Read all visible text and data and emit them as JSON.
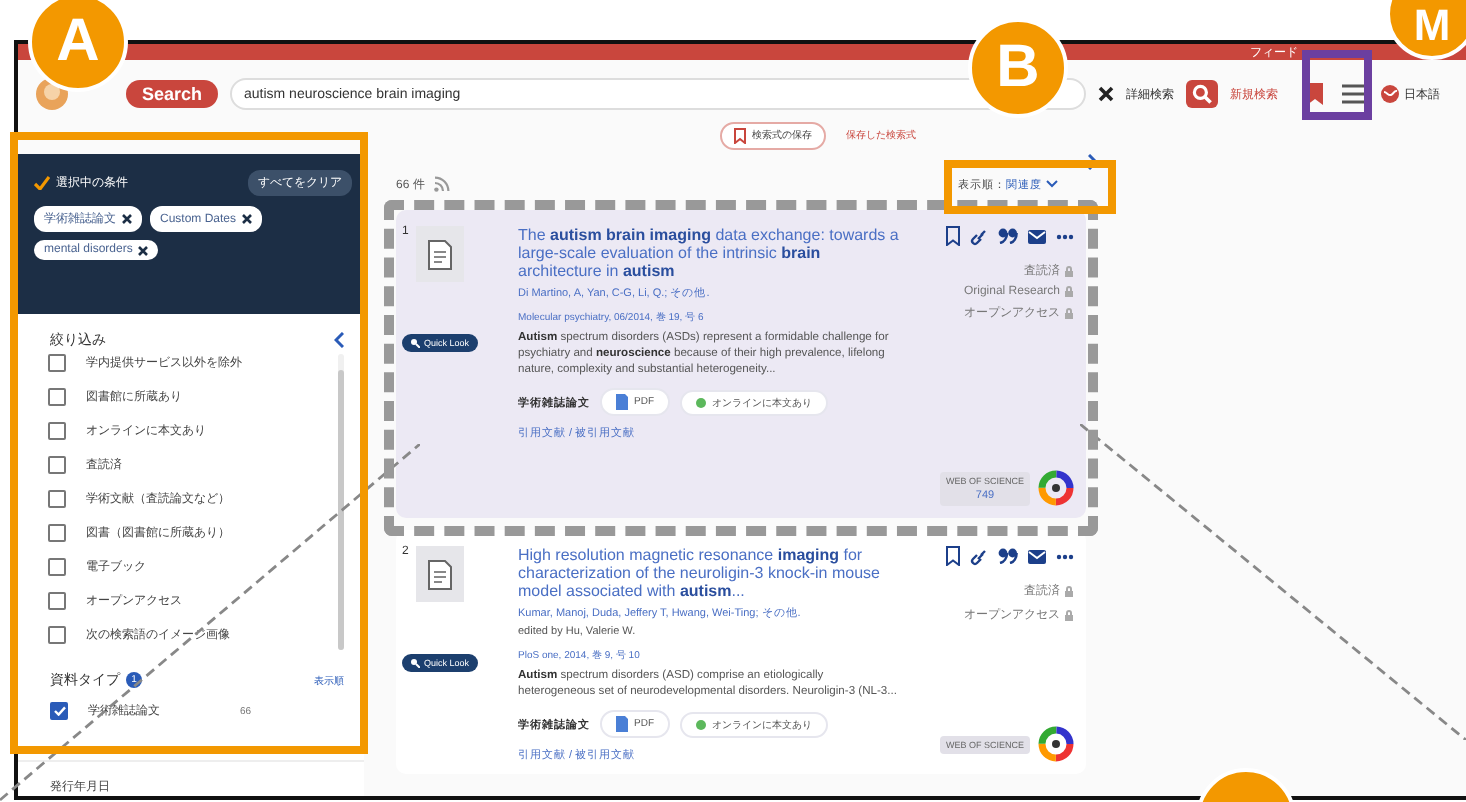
{
  "top_bar": {
    "text": "フィード"
  },
  "header": {
    "logo": "Search",
    "query": "autism neuroscience brain imaging",
    "advanced": "詳細検索",
    "new_search": "新規検索",
    "language": "日本語"
  },
  "sub_bar": {
    "save_query": "検索式の保存",
    "saved_queries": "保存した検索式"
  },
  "filters": {
    "title": "選択中の条件",
    "clear": "すべてをクリア",
    "chips": [
      "学術雑誌論文",
      "Custom Dates",
      "mental disorders"
    ],
    "refine_title": "絞り込み",
    "options": [
      {
        "label": "学内提供サービス以外を除外",
        "checked": false
      },
      {
        "label": "図書館に所蔵あり",
        "checked": false
      },
      {
        "label": "オンラインに本文あり",
        "checked": false
      },
      {
        "label": "査読済",
        "checked": false
      },
      {
        "label": "学術文献（査読論文など）",
        "checked": false
      },
      {
        "label": "図書（図書館に所蔵あり）",
        "checked": false
      },
      {
        "label": "電子ブック",
        "checked": false
      },
      {
        "label": "オープンアクセス",
        "checked": false
      },
      {
        "label": "次の検索語のイメージ画像",
        "checked": false
      }
    ],
    "type_section": {
      "title": "資料タイプ",
      "badge": "1",
      "sort": "表示順",
      "items": [
        {
          "label": "学術雑誌論文",
          "count": "66",
          "checked": true
        }
      ]
    },
    "date_section": "発行年月日"
  },
  "results_head": {
    "count": "66 件",
    "sort_label": "表示順：",
    "sort_value": "関連度"
  },
  "results": [
    {
      "number": "1",
      "highlighted": true,
      "title": "The **autism brain imaging** data exchange: towards a large-scale evaluation of the intrinsic **brain** architecture in **autism**",
      "authors": "Di Martino, A, Yan, C-G, Li, Q.; その他.",
      "source": "Molecular psychiatry, 06/2014, 巻 19, 号 6",
      "quick_look": "Quick Look",
      "abstract": "**Autism** spectrum disorders (ASDs) represent a formidable challenge for psychiatry and **neuroscience** because of their high prevalence, lifelong nature, complexity and substantial heterogeneity...",
      "type": "学術雑誌論文",
      "pdf": "PDF",
      "online": "オンラインに本文あり",
      "links": "引用文献 / 被引用文献",
      "tags": [
        "査読済",
        "Original Research",
        "オープンアクセス"
      ],
      "wos": "WEB OF SCIENCE",
      "wos_count": "749"
    },
    {
      "number": "2",
      "highlighted": false,
      "title": "High resolution magnetic resonance **imaging** for characterization of the neuroligin-3 knock-in mouse model associated with **autism**...",
      "authors": "Kumar, Manoj, Duda, Jeffery T, Hwang, Wei-Ting; その他.",
      "edited": "edited by Hu, Valerie W.",
      "source": "PloS one, 2014, 巻 9, 号 10",
      "quick_look": "Quick Look",
      "abstract": "**Autism** spectrum disorders (ASD) comprise an etiologically heterogeneous set of neurodevelopmental disorders. Neuroligin-3 (NL-3...",
      "type": "学術雑誌論文",
      "pdf": "PDF",
      "online": "オンラインに本文あり",
      "links": "引用文献 / 被引用文献",
      "tags": [
        "査読済",
        "オープンアクセス"
      ],
      "wos": "WEB OF SCIENCE"
    }
  ],
  "callouts": [
    {
      "label": "A",
      "kind": "orange"
    },
    {
      "label": "B",
      "kind": "orange"
    },
    {
      "label": "M",
      "kind": "orange"
    }
  ]
}
